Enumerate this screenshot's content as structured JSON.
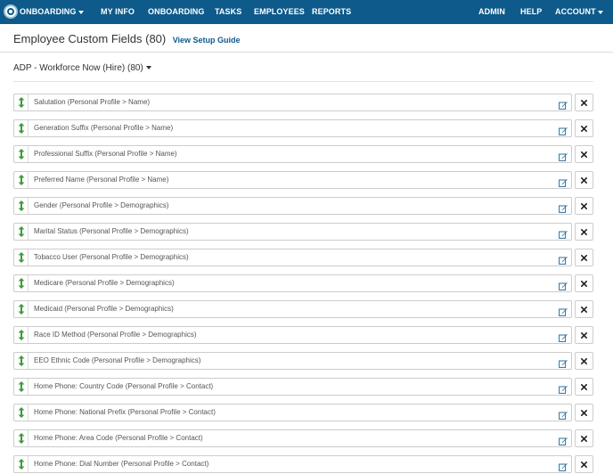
{
  "navbar": {
    "brand_label": "ONBOARDING",
    "links": [
      "MY INFO",
      "ONBOARDING",
      "TASKS",
      "EMPLOYEES",
      "REPORTS"
    ],
    "right_links": [
      "ADMIN",
      "HELP"
    ],
    "account_label": "ACCOUNT"
  },
  "page": {
    "title": "Employee Custom Fields (80)",
    "setup_link": "View Setup Guide"
  },
  "section": {
    "title": "ADP - Workforce Now (Hire) (80)"
  },
  "fields": [
    "Salutation (Personal Profile > Name)",
    "Generation Suffix (Personal Profile > Name)",
    "Professional Suffix (Personal Profile > Name)",
    "Preferred Name (Personal Profile > Name)",
    "Gender (Personal Profile > Demographics)",
    "Marital Status (Personal Profile > Demographics)",
    "Tobacco User (Personal Profile > Demographics)",
    "Medicare (Personal Profile > Demographics)",
    "Medicaid (Personal Profile > Demographics)",
    "Race ID Method (Personal Profile > Demographics)",
    "EEO Ethnic Code (Personal Profile > Demographics)",
    "Home Phone: Country Code (Personal Profile > Contact)",
    "Home Phone: National Prefix (Personal Profile > Contact)",
    "Home Phone: Area Code (Personal Profile > Contact)",
    "Home Phone: Dial Number (Personal Profile > Contact)"
  ],
  "colors": {
    "navbar_bg": "#0e5a8a",
    "drag_handle": "#3c9a3c",
    "edit_icon": "#2a6f9e",
    "link": "#0e5a8a"
  },
  "icons": {
    "drag": "drag-handle-icon",
    "edit": "edit-icon",
    "delete": "close-icon"
  }
}
